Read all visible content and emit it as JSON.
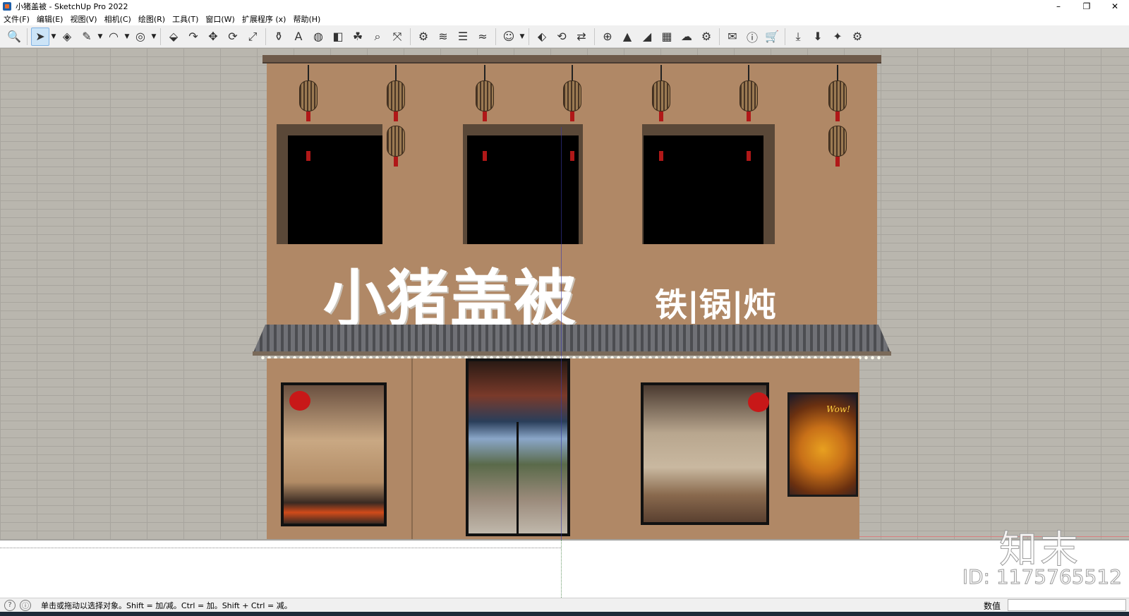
{
  "window": {
    "title": "小猪盖被 - SketchUp Pro 2022",
    "controls": {
      "minimize": "–",
      "maximize": "❐",
      "close": "✕"
    }
  },
  "menu": [
    "文件(F)",
    "编辑(E)",
    "视图(V)",
    "相机(C)",
    "绘图(R)",
    "工具(T)",
    "窗口(W)",
    "扩展程序 (x)",
    "帮助(H)"
  ],
  "toolbar": {
    "tools": [
      {
        "icon": "zoom-icon",
        "glyph": "🔍"
      },
      {
        "icon": "select-arrow-icon",
        "glyph": "➤",
        "active": true
      },
      {
        "icon": "eraser-icon",
        "glyph": "◈"
      },
      {
        "icon": "pencil-icon",
        "glyph": "✎"
      },
      {
        "icon": "arc-icon",
        "glyph": "◠"
      },
      {
        "icon": "tape-measure-icon",
        "glyph": "◎"
      },
      {
        "icon": "push-pull-icon",
        "glyph": "⬙"
      },
      {
        "icon": "follow-me-icon",
        "glyph": "↷"
      },
      {
        "icon": "move-icon",
        "glyph": "✥"
      },
      {
        "icon": "rotate-icon",
        "glyph": "⟳"
      },
      {
        "icon": "scale-icon",
        "glyph": "⤢"
      },
      {
        "icon": "paint-bucket-icon",
        "glyph": "⚱"
      },
      {
        "icon": "text-label-icon",
        "glyph": "A"
      },
      {
        "icon": "materials-icon",
        "glyph": "◍"
      },
      {
        "icon": "section-plane-icon",
        "glyph": "◧"
      },
      {
        "icon": "walk-icon",
        "glyph": "☘"
      },
      {
        "icon": "zoom-window-icon",
        "glyph": "⌕"
      },
      {
        "icon": "zoom-extents-icon",
        "glyph": "⤧"
      },
      {
        "icon": "styles-icon",
        "glyph": "⚙"
      },
      {
        "icon": "layers-icon",
        "glyph": "≋"
      },
      {
        "icon": "stack-icon",
        "glyph": "☰"
      },
      {
        "icon": "sandbox-icon",
        "glyph": "≈"
      },
      {
        "icon": "account-icon",
        "glyph": "☺"
      },
      {
        "icon": "extension-warehouse-icon",
        "glyph": "⬖"
      },
      {
        "icon": "sync-icon",
        "glyph": "⟲"
      },
      {
        "icon": "send-to-layout-icon",
        "glyph": "⇄"
      },
      {
        "icon": "add-circle-icon",
        "glyph": "⊕"
      },
      {
        "icon": "tree-icon",
        "glyph": "▲"
      },
      {
        "icon": "terrain-icon",
        "glyph": "◢"
      },
      {
        "icon": "checker-icon",
        "glyph": "▦"
      },
      {
        "icon": "cloud-upload-icon",
        "glyph": "☁"
      },
      {
        "icon": "gear-cluster-icon",
        "glyph": "⚙"
      },
      {
        "icon": "mail-icon",
        "glyph": "✉"
      },
      {
        "icon": "info-icon",
        "glyph": "ⓘ"
      },
      {
        "icon": "cart-icon",
        "glyph": "🛒"
      },
      {
        "icon": "download-icon",
        "glyph": "⤓"
      },
      {
        "icon": "layer-down-icon",
        "glyph": "⬇"
      },
      {
        "icon": "rocket-icon",
        "glyph": "✦"
      },
      {
        "icon": "settings-icon",
        "glyph": "⚙"
      }
    ]
  },
  "scene": {
    "sign_main": "小猪盖被",
    "sign_sub": "铁|锅|炖",
    "poster_text": "Wow!"
  },
  "watermark": {
    "logo": "知末",
    "id": "ID: 1175765512"
  },
  "status": {
    "hint": "单击或拖动以选择对象。Shift = 加/减。Ctrl = 加。Shift + Ctrl = 减。",
    "measurements_label": "数值",
    "measurements_value": ""
  }
}
